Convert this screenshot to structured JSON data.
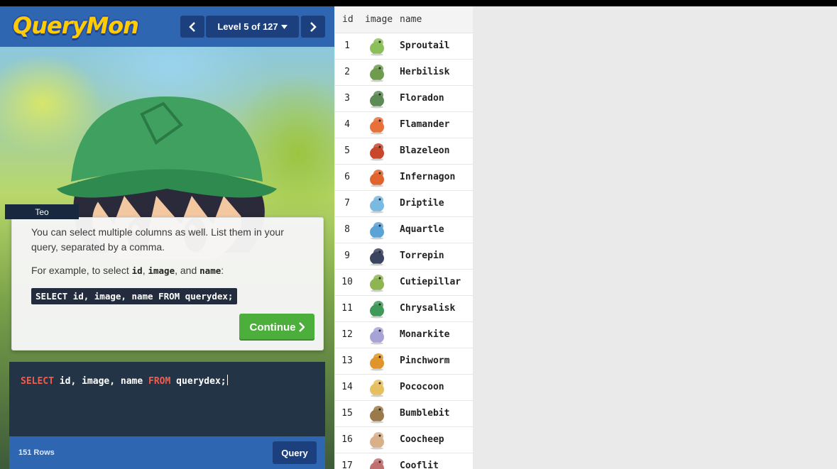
{
  "header": {
    "logo": "QueryMon",
    "level_label": "Level 5 of 127",
    "prev_icon": "chevron-left-icon",
    "next_icon": "chevron-right-icon"
  },
  "dialog": {
    "speaker": "Teo",
    "line1": "You can select multiple columns as well. List them in your query, separated by a comma.",
    "line2_prefix": "For example, to select ",
    "col1": "id",
    "sep1": ", ",
    "col2": "image",
    "sep2": ", and ",
    "col3": "name",
    "line2_suffix": ":",
    "code_example": "SELECT id, image, name FROM querydex;",
    "continue_label": "Continue"
  },
  "editor": {
    "kw_select": "SELECT",
    "columns": " id, image, name ",
    "kw_from": "FROM",
    "table": " querydex;"
  },
  "footer": {
    "rows_count": "151 Rows",
    "query_label": "Query"
  },
  "results": {
    "columns": [
      "id",
      "image",
      "name"
    ],
    "rows": [
      {
        "id": "1",
        "name": "Sproutail",
        "color": "#8bbf5a"
      },
      {
        "id": "2",
        "name": "Herbilisk",
        "color": "#6f9b4e"
      },
      {
        "id": "3",
        "name": "Floradon",
        "color": "#5d8a55"
      },
      {
        "id": "4",
        "name": "Flamander",
        "color": "#e8703a"
      },
      {
        "id": "5",
        "name": "Blazeleon",
        "color": "#c9462c"
      },
      {
        "id": "6",
        "name": "Infernagon",
        "color": "#e0632e"
      },
      {
        "id": "7",
        "name": "Driptile",
        "color": "#7ab9e0"
      },
      {
        "id": "8",
        "name": "Aquartle",
        "color": "#5aa3d6"
      },
      {
        "id": "9",
        "name": "Torrepin",
        "color": "#3b4560"
      },
      {
        "id": "10",
        "name": "Cutiepillar",
        "color": "#8fb552"
      },
      {
        "id": "11",
        "name": "Chrysalisk",
        "color": "#3f9a5a"
      },
      {
        "id": "12",
        "name": "Monarkite",
        "color": "#a7a3d6"
      },
      {
        "id": "13",
        "name": "Pinchworm",
        "color": "#e0952c"
      },
      {
        "id": "14",
        "name": "Pococoon",
        "color": "#e6c060"
      },
      {
        "id": "15",
        "name": "Bumblebit",
        "color": "#9a7a4a"
      },
      {
        "id": "16",
        "name": "Coocheep",
        "color": "#d8b08a"
      },
      {
        "id": "17",
        "name": "Cooflit",
        "color": "#c07070"
      }
    ]
  }
}
